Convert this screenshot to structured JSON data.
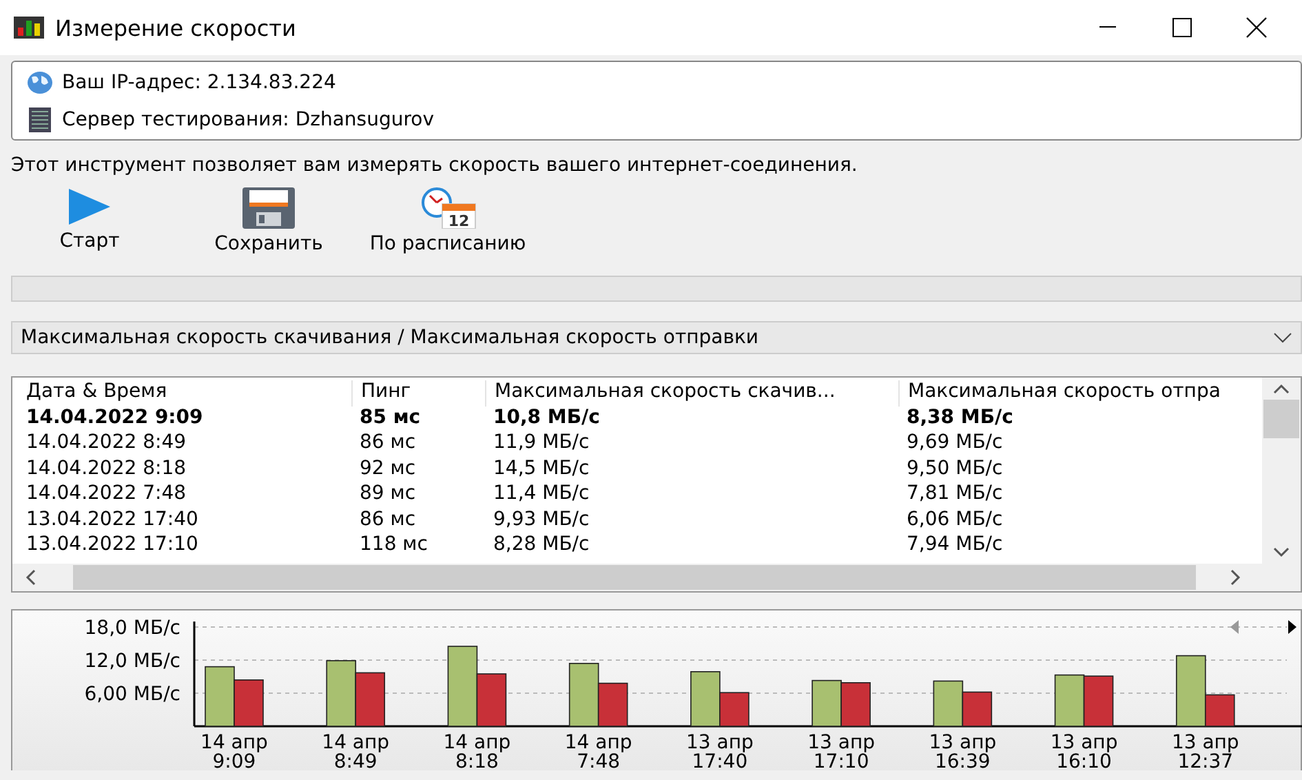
{
  "window": {
    "title": "Измерение скорости"
  },
  "info": [
    {
      "kind": "globe",
      "text": "Ваш IP-адрес: 2.134.83.224"
    },
    {
      "kind": "server",
      "text": "Сервер тестирования: Dzhansugurov"
    }
  ],
  "description": "Этот инструмент позволяет вам измерять скорость вашего интернет-соединения.",
  "toolbar": [
    {
      "kind": "play",
      "label": "Старт"
    },
    {
      "kind": "save",
      "label": "Сохранить"
    },
    {
      "kind": "schedule",
      "label": "По расписанию",
      "badge": "12"
    }
  ],
  "progress": {
    "level": 0
  },
  "view_select": {
    "value": "Максимальная скорость скачивания / Максимальная скорость отправки"
  },
  "table": {
    "columns": [
      "Дата & Время",
      "Пинг",
      "Максимальная скорость скачив...",
      "Максимальная скорость отпра"
    ],
    "rows": [
      {
        "current": true,
        "cells": [
          "14.04.2022 9:09",
          "85 мс",
          "10,8 МБ/с",
          "8,38 МБ/с"
        ]
      },
      {
        "current": false,
        "cells": [
          "14.04.2022 8:49",
          "86 мс",
          "11,9 МБ/с",
          "9,69 МБ/с"
        ]
      },
      {
        "current": false,
        "cells": [
          "14.04.2022 8:18",
          "92 мс",
          "14,5 МБ/с",
          "9,50 МБ/с"
        ]
      },
      {
        "current": false,
        "cells": [
          "14.04.2022 7:48",
          "89 мс",
          "11,4 МБ/с",
          "7,81 МБ/с"
        ]
      },
      {
        "current": false,
        "cells": [
          "13.04.2022 17:40",
          "86 мс",
          "9,93 МБ/с",
          "6,06 МБ/с"
        ]
      },
      {
        "current": false,
        "cells": [
          "13.04.2022 17:10",
          "118 мс",
          "8,28 МБ/с",
          "7,94 МБ/с"
        ]
      }
    ]
  },
  "chart": {
    "chart_data": {
      "type": "bar",
      "categories": [
        "14 апр\n9:09",
        "14 апр\n8:49",
        "14 апр\n8:18",
        "14 апр\n7:48",
        "13 апр\n17:40",
        "13 апр\n17:10",
        "13 апр\n16:39",
        "13 апр\n16:10",
        "13 апр\n12:37"
      ],
      "series": [
        {
          "color": "#a8c070",
          "values": [
            10.8,
            11.9,
            14.5,
            11.4,
            9.9,
            8.3,
            8.2,
            9.3,
            12.8
          ]
        },
        {
          "color": "#c83038",
          "values": [
            8.4,
            9.7,
            9.5,
            7.8,
            6.1,
            7.9,
            6.2,
            9.1,
            5.7
          ]
        }
      ],
      "ylim": [
        0,
        18
      ],
      "yticks": [
        {
          "value": 6,
          "label": "6,00 МБ/с"
        },
        {
          "value": 12,
          "label": "12,0 МБ/с"
        },
        {
          "value": 18,
          "label": "18,0 МБ/с"
        }
      ]
    }
  }
}
